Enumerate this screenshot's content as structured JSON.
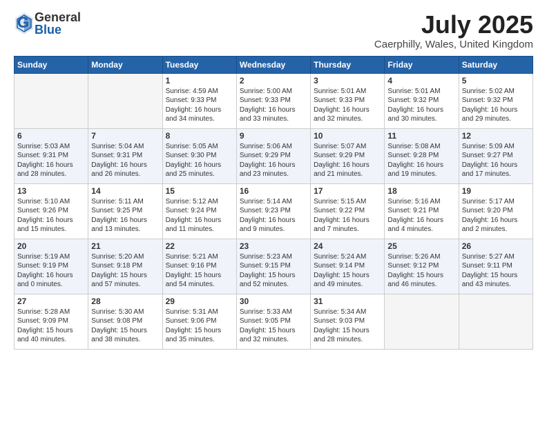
{
  "header": {
    "logo": {
      "line1": "General",
      "line2": "Blue"
    },
    "title": "July 2025",
    "location": "Caerphilly, Wales, United Kingdom"
  },
  "weekdays": [
    "Sunday",
    "Monday",
    "Tuesday",
    "Wednesday",
    "Thursday",
    "Friday",
    "Saturday"
  ],
  "weeks": [
    [
      {
        "day": "",
        "detail": ""
      },
      {
        "day": "",
        "detail": ""
      },
      {
        "day": "1",
        "detail": "Sunrise: 4:59 AM\nSunset: 9:33 PM\nDaylight: 16 hours\nand 34 minutes."
      },
      {
        "day": "2",
        "detail": "Sunrise: 5:00 AM\nSunset: 9:33 PM\nDaylight: 16 hours\nand 33 minutes."
      },
      {
        "day": "3",
        "detail": "Sunrise: 5:01 AM\nSunset: 9:33 PM\nDaylight: 16 hours\nand 32 minutes."
      },
      {
        "day": "4",
        "detail": "Sunrise: 5:01 AM\nSunset: 9:32 PM\nDaylight: 16 hours\nand 30 minutes."
      },
      {
        "day": "5",
        "detail": "Sunrise: 5:02 AM\nSunset: 9:32 PM\nDaylight: 16 hours\nand 29 minutes."
      }
    ],
    [
      {
        "day": "6",
        "detail": "Sunrise: 5:03 AM\nSunset: 9:31 PM\nDaylight: 16 hours\nand 28 minutes."
      },
      {
        "day": "7",
        "detail": "Sunrise: 5:04 AM\nSunset: 9:31 PM\nDaylight: 16 hours\nand 26 minutes."
      },
      {
        "day": "8",
        "detail": "Sunrise: 5:05 AM\nSunset: 9:30 PM\nDaylight: 16 hours\nand 25 minutes."
      },
      {
        "day": "9",
        "detail": "Sunrise: 5:06 AM\nSunset: 9:29 PM\nDaylight: 16 hours\nand 23 minutes."
      },
      {
        "day": "10",
        "detail": "Sunrise: 5:07 AM\nSunset: 9:29 PM\nDaylight: 16 hours\nand 21 minutes."
      },
      {
        "day": "11",
        "detail": "Sunrise: 5:08 AM\nSunset: 9:28 PM\nDaylight: 16 hours\nand 19 minutes."
      },
      {
        "day": "12",
        "detail": "Sunrise: 5:09 AM\nSunset: 9:27 PM\nDaylight: 16 hours\nand 17 minutes."
      }
    ],
    [
      {
        "day": "13",
        "detail": "Sunrise: 5:10 AM\nSunset: 9:26 PM\nDaylight: 16 hours\nand 15 minutes."
      },
      {
        "day": "14",
        "detail": "Sunrise: 5:11 AM\nSunset: 9:25 PM\nDaylight: 16 hours\nand 13 minutes."
      },
      {
        "day": "15",
        "detail": "Sunrise: 5:12 AM\nSunset: 9:24 PM\nDaylight: 16 hours\nand 11 minutes."
      },
      {
        "day": "16",
        "detail": "Sunrise: 5:14 AM\nSunset: 9:23 PM\nDaylight: 16 hours\nand 9 minutes."
      },
      {
        "day": "17",
        "detail": "Sunrise: 5:15 AM\nSunset: 9:22 PM\nDaylight: 16 hours\nand 7 minutes."
      },
      {
        "day": "18",
        "detail": "Sunrise: 5:16 AM\nSunset: 9:21 PM\nDaylight: 16 hours\nand 4 minutes."
      },
      {
        "day": "19",
        "detail": "Sunrise: 5:17 AM\nSunset: 9:20 PM\nDaylight: 16 hours\nand 2 minutes."
      }
    ],
    [
      {
        "day": "20",
        "detail": "Sunrise: 5:19 AM\nSunset: 9:19 PM\nDaylight: 16 hours\nand 0 minutes."
      },
      {
        "day": "21",
        "detail": "Sunrise: 5:20 AM\nSunset: 9:18 PM\nDaylight: 15 hours\nand 57 minutes."
      },
      {
        "day": "22",
        "detail": "Sunrise: 5:21 AM\nSunset: 9:16 PM\nDaylight: 15 hours\nand 54 minutes."
      },
      {
        "day": "23",
        "detail": "Sunrise: 5:23 AM\nSunset: 9:15 PM\nDaylight: 15 hours\nand 52 minutes."
      },
      {
        "day": "24",
        "detail": "Sunrise: 5:24 AM\nSunset: 9:14 PM\nDaylight: 15 hours\nand 49 minutes."
      },
      {
        "day": "25",
        "detail": "Sunrise: 5:26 AM\nSunset: 9:12 PM\nDaylight: 15 hours\nand 46 minutes."
      },
      {
        "day": "26",
        "detail": "Sunrise: 5:27 AM\nSunset: 9:11 PM\nDaylight: 15 hours\nand 43 minutes."
      }
    ],
    [
      {
        "day": "27",
        "detail": "Sunrise: 5:28 AM\nSunset: 9:09 PM\nDaylight: 15 hours\nand 40 minutes."
      },
      {
        "day": "28",
        "detail": "Sunrise: 5:30 AM\nSunset: 9:08 PM\nDaylight: 15 hours\nand 38 minutes."
      },
      {
        "day": "29",
        "detail": "Sunrise: 5:31 AM\nSunset: 9:06 PM\nDaylight: 15 hours\nand 35 minutes."
      },
      {
        "day": "30",
        "detail": "Sunrise: 5:33 AM\nSunset: 9:05 PM\nDaylight: 15 hours\nand 32 minutes."
      },
      {
        "day": "31",
        "detail": "Sunrise: 5:34 AM\nSunset: 9:03 PM\nDaylight: 15 hours\nand 28 minutes."
      },
      {
        "day": "",
        "detail": ""
      },
      {
        "day": "",
        "detail": ""
      }
    ]
  ]
}
